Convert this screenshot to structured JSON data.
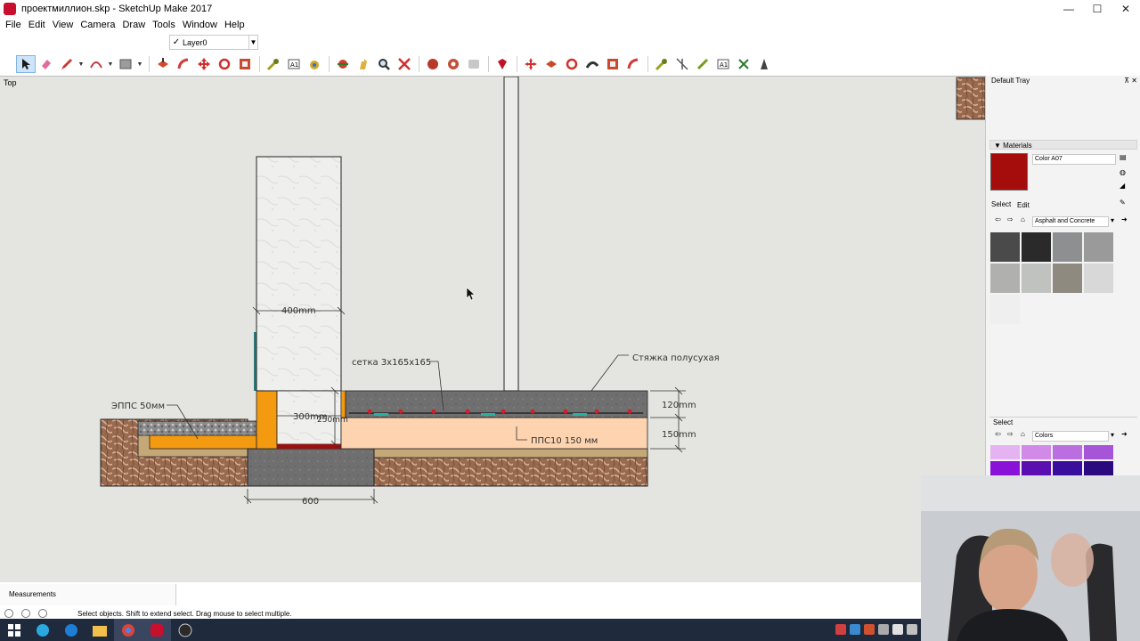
{
  "window": {
    "title": "проектмиллион.skp - SketchUp Make 2017",
    "controls": {
      "minimize": "—",
      "maximize": "☐",
      "close": "✕"
    }
  },
  "menu": [
    "File",
    "Edit",
    "View",
    "Camera",
    "Draw",
    "Tools",
    "Window",
    "Help"
  ],
  "layer": {
    "check": "✓",
    "name": "Layer0"
  },
  "toolbar_tools": [
    "select-tool-icon",
    "eraser-icon",
    "pencil-icon",
    "arc-icon",
    "rectangle-icon",
    "push-pull-icon",
    "follow-me-icon",
    "move-icon",
    "rotate-icon",
    "scale-icon",
    "tape-measure-icon",
    "text-icon",
    "paint-bucket-icon",
    "orbit-icon",
    "pan-icon",
    "zoom-icon",
    "zoom-extents-icon",
    "warehouse-icon",
    "extension-icon",
    "layout-icon",
    "ruby-icon",
    "move-arrows-icon",
    "push-pull-2-icon",
    "rotate-2-icon",
    "follow-me-2-icon",
    "scale-2-icon",
    "offset-icon",
    "dimension-icon",
    "protractor-icon",
    "section-plane-icon",
    "axes-icon",
    "3d-text-icon",
    "sandbox-icon"
  ],
  "viewport": {
    "scene": "Top",
    "labels": {
      "dim_400": "400mm",
      "mesh": "сетка 3х165х165",
      "screed": "Стяжка полусухая",
      "epps": "ЭППС 50мм",
      "dim_300": "300mm",
      "dim_250": "250mm",
      "dim_120": "120mm",
      "dim_150": "150mm",
      "pps": "ППС10 150 мм",
      "dim_600": "600"
    }
  },
  "tray": {
    "title": "Default Tray",
    "materials": {
      "heading": "Materials",
      "current_name": "Color A07",
      "current_color": "#a50c0c",
      "tabs": {
        "select": "Select",
        "edit": "Edit"
      },
      "library": "Asphalt and Concrete",
      "swatches": [
        "#4a4a4a",
        "#2a2a2a",
        "#8d8f90",
        "#9a9a9a",
        "#b0b0ae",
        "#c0c2c0",
        "#8e8a80",
        "#d8d8d8",
        "#efefef"
      ]
    },
    "select_panel": {
      "heading": "Select",
      "library": "Colors",
      "swatches": [
        "#e6b3f2",
        "#d18ae8",
        "#bb6ee0",
        "#a654d8",
        "#8a12d8",
        "#5c0fb0",
        "#3a0e9c",
        "#2b0a80"
      ]
    }
  },
  "measurements": {
    "label": "Measurements"
  },
  "status": {
    "message": "Select objects. Shift to extend select. Drag mouse to select multiple."
  },
  "taskbar": [
    "windows-start-icon",
    "edge-icon",
    "chrome-icon",
    "file-explorer-icon",
    "chrome-2-icon",
    "sketchup-icon",
    "obs-icon"
  ]
}
